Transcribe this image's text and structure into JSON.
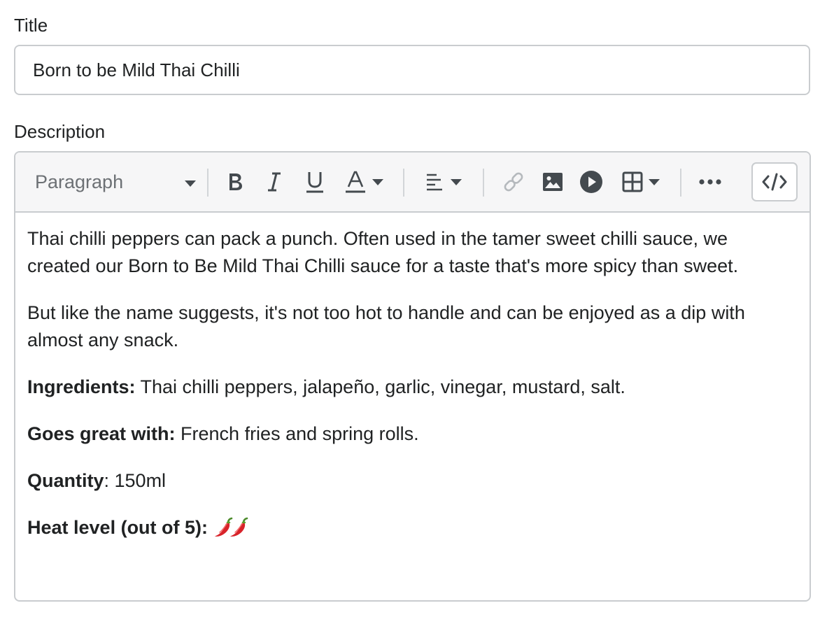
{
  "title_field": {
    "label": "Title",
    "value": "Born to be Mild Thai Chilli"
  },
  "description_field": {
    "label": "Description",
    "toolbar": {
      "block_format": "Paragraph",
      "bold_icon": "bold-icon",
      "italic_icon": "italic-icon",
      "underline_icon": "underline-icon",
      "text_color_icon": "text-color-icon",
      "align_icon": "align-left-icon",
      "link_icon": "link-icon",
      "image_icon": "image-icon",
      "video_icon": "play-icon",
      "table_icon": "table-icon",
      "more_icon": "more-icon",
      "source_icon": "code-icon"
    },
    "content": {
      "p1": "Thai chilli peppers can pack a punch. Often used in the tamer sweet chilli sauce, we created our Born to Be Mild Thai Chilli sauce for a taste that's more spicy than sweet.",
      "p2": "But like the name suggests, it's not too hot to handle and can be enjoyed as a dip with almost any snack.",
      "ingredients_label": "Ingredients:",
      "ingredients_text": " Thai chilli peppers, jalapeño, garlic, vinegar, mustard, salt.",
      "goes_with_label": "Goes great with:",
      "goes_with_text": " French fries and spring rolls.",
      "quantity_label": "Quantity",
      "quantity_text": ": 150ml",
      "heat_label": "Heat level (out of 5):",
      "heat_level": 2,
      "heat_icon": "chili-pepper-icon"
    }
  },
  "colors": {
    "border": "#c9cccf",
    "toolbar_bg": "#f6f6f7",
    "text": "#202223",
    "icon": "#444a4f",
    "disabled_icon": "#b5b9bd"
  }
}
